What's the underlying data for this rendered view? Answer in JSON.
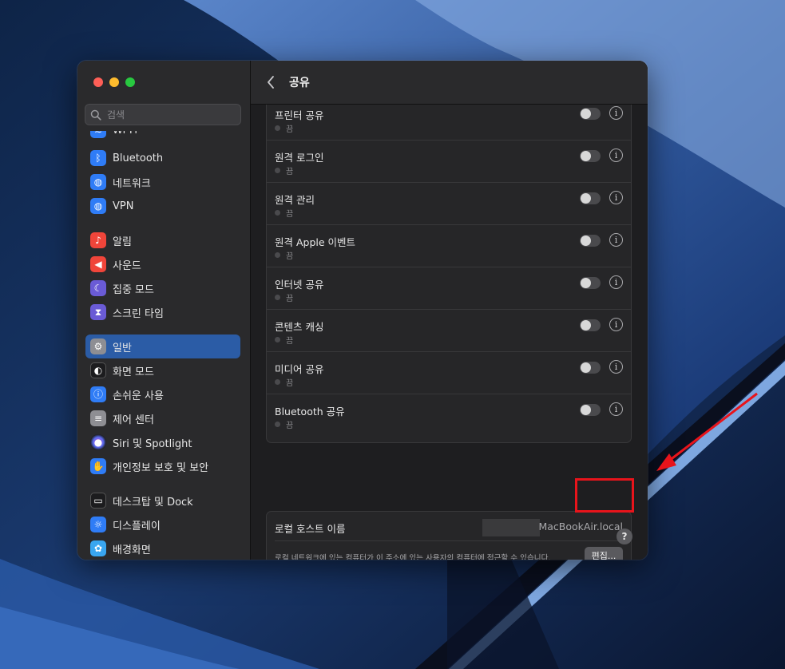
{
  "colors": {
    "accent": "#2b5ca6",
    "highlight": "#e8141b"
  },
  "search": {
    "placeholder": "검색",
    "icon": "search-icon"
  },
  "sidebar": {
    "items": [
      {
        "label": "Wi-Fi",
        "icon": "wifi-icon",
        "color": "#2f7cf6"
      },
      {
        "label": "Bluetooth",
        "icon": "bluetooth-icon",
        "color": "#2f7cf6"
      },
      {
        "label": "네트워크",
        "icon": "globe-icon",
        "color": "#2f7cf6"
      },
      {
        "label": "VPN",
        "icon": "vpn-globe-icon",
        "color": "#2f7cf6"
      },
      {
        "label": "알림",
        "icon": "bell-icon",
        "color": "#f0453a"
      },
      {
        "label": "사운드",
        "icon": "speaker-icon",
        "color": "#f0453a"
      },
      {
        "label": "집중 모드",
        "icon": "moon-icon",
        "color": "#6a5bd6"
      },
      {
        "label": "스크린 타임",
        "icon": "hourglass-icon",
        "color": "#6a5bd6"
      },
      {
        "label": "일반",
        "icon": "gear-icon",
        "color": "#8e8e93"
      },
      {
        "label": "화면 모드",
        "icon": "appearance-icon",
        "color": "#1c1c1e"
      },
      {
        "label": "손쉬운 사용",
        "icon": "accessibility-icon",
        "color": "#2f7cf6"
      },
      {
        "label": "제어 센터",
        "icon": "control-center-icon",
        "color": "#8e8e93"
      },
      {
        "label": "Siri 및 Spotlight",
        "icon": "siri-icon",
        "color": "#2b2b2e"
      },
      {
        "label": "개인정보 보호 및 보안",
        "icon": "hand-icon",
        "color": "#2f7cf6"
      },
      {
        "label": "데스크탑 및 Dock",
        "icon": "dock-icon",
        "color": "#1c1c1e"
      },
      {
        "label": "디스플레이",
        "icon": "sun-icon",
        "color": "#2f7cf6"
      },
      {
        "label": "배경화면",
        "icon": "flower-icon",
        "color": "#39a6f0"
      }
    ]
  },
  "header": {
    "title": "공유",
    "back_icon": "chevron-left-icon"
  },
  "services": [
    {
      "name": "프린터 공유",
      "status": "끔"
    },
    {
      "name": "원격 로그인",
      "status": "끔"
    },
    {
      "name": "원격 관리",
      "status": "끔"
    },
    {
      "name": "원격 Apple 이벤트",
      "status": "끔"
    },
    {
      "name": "인터넷 공유",
      "status": "끔"
    },
    {
      "name": "콘텐츠 캐싱",
      "status": "끔"
    },
    {
      "name": "미디어 공유",
      "status": "끔"
    },
    {
      "name": "Bluetooth 공유",
      "status": "끔"
    }
  ],
  "service_toggle_state": "off",
  "host": {
    "label": "로컬 호스트 이름",
    "value": "MacBookAir.local",
    "description": "로컬 네트워크에 있는 컴퓨터가 이 주소에 있는 사용자의 컴퓨터에 접근할 수 있습니다.",
    "edit_label": "편집..."
  },
  "help": {
    "label": "?"
  }
}
